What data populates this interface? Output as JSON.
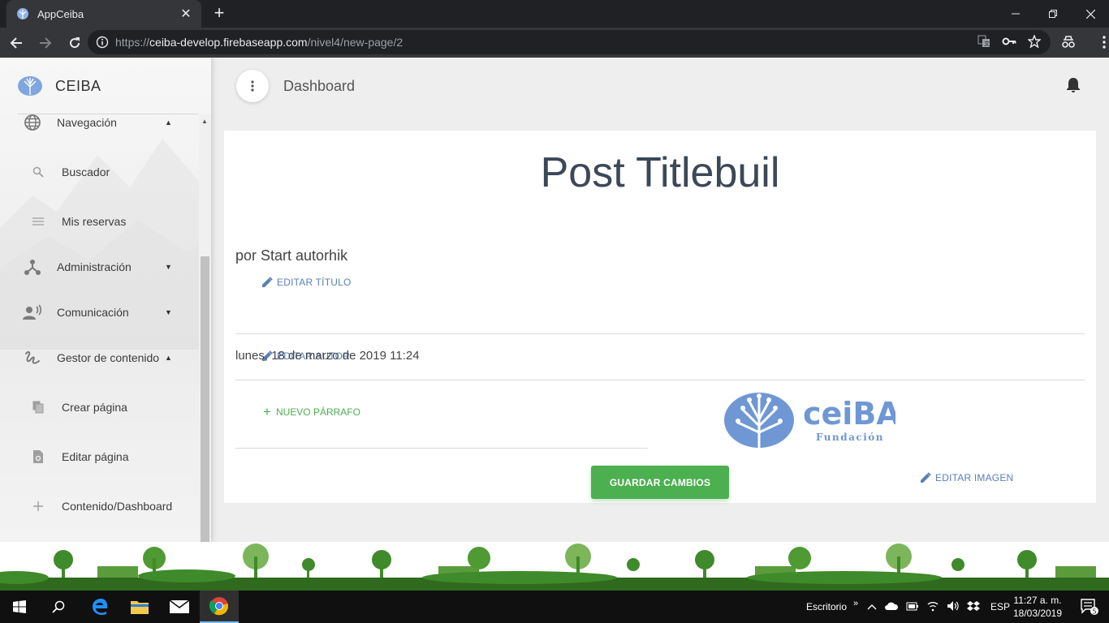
{
  "browser": {
    "tab_title": "AppCeiba",
    "tab_close": "✕",
    "new_tab": "+",
    "url_scheme": "https://",
    "url_host": "ceiba-develop.firebaseapp.com",
    "url_path": "/nivel4/new-page/2"
  },
  "sidebar": {
    "brand": "CEIBA",
    "items": [
      {
        "label": "Navegación",
        "icon": "globe-icon",
        "expanded": true
      },
      {
        "label": "Buscador",
        "icon": "search-icon"
      },
      {
        "label": "Mis reservas",
        "icon": "list-icon"
      },
      {
        "label": "Administración",
        "icon": "hub-icon",
        "expanded": false
      },
      {
        "label": "Comunicación",
        "icon": "record-voice-icon",
        "expanded": false
      },
      {
        "label": "Gestor de contenido",
        "icon": "gesture-icon",
        "expanded": true
      },
      {
        "label": "Crear página",
        "icon": "file-copy-icon"
      },
      {
        "label": "Editar página",
        "icon": "file-settings-icon"
      },
      {
        "label": "Contenido/Dashboard",
        "icon": "add-icon"
      }
    ]
  },
  "header": {
    "title": "Dashboard"
  },
  "post": {
    "title": "Post Titlebuil",
    "edit_title": "EDITAR TÍTULO",
    "author": "por Start autorhik",
    "edit_author": "EDITAR AUTOR",
    "date": "lunes, 18 de marzo de 2019 11:24",
    "new_paragraph": "NUEVO PÁRRAFO",
    "edit_image": "EDITAR IMAGEN",
    "logo_word": "ceiBA",
    "logo_sub": "Fundación",
    "save": "GUARDAR CAMBIOS"
  },
  "taskbar": {
    "desktop_label": "Escritorio",
    "chevron": "»",
    "lang": "ESP",
    "time": "11:27 a. m.",
    "date": "18/03/2019",
    "notifications": "5"
  },
  "colors": {
    "accent_blue": "#5b7fb5",
    "green": "#4caf50",
    "logo_blue": "#6f97d3"
  }
}
